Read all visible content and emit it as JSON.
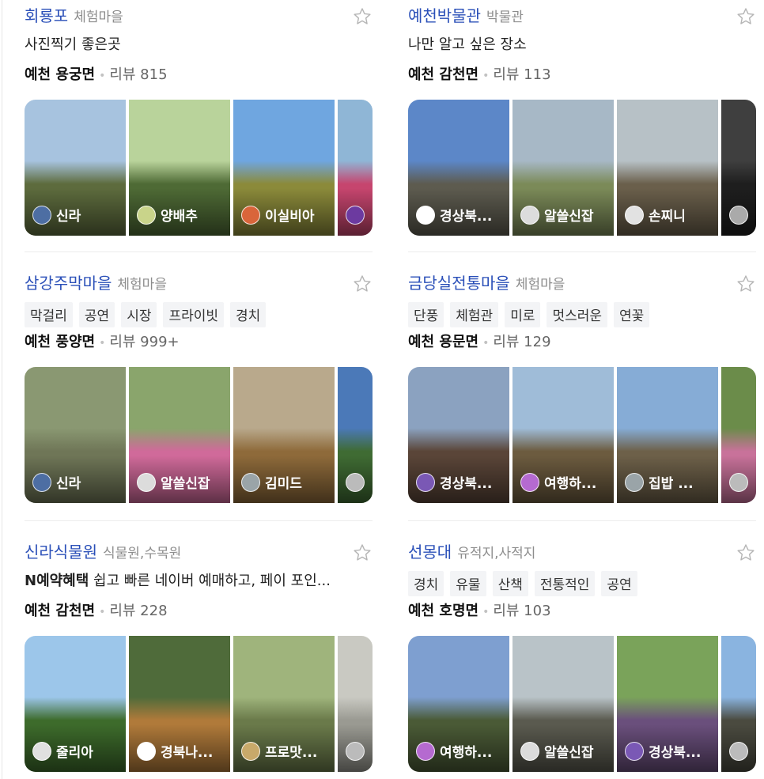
{
  "cards": [
    {
      "name": "회룡포",
      "category": "체험마을",
      "desc": "사진찍기 좋은곳",
      "location": "예천 용궁면",
      "reviews": "리뷰 815",
      "photos": [
        {
          "author": "신라",
          "sky": "#a7c3df",
          "land": "#5d6b3d",
          "av": "#4d6ea3"
        },
        {
          "author": "양배추",
          "sky": "#b9d39b",
          "land": "#4e6a35",
          "av": "#c9d48a"
        },
        {
          "author": "이실비아",
          "sky": "#6fa6e0",
          "land": "#8b8a3a",
          "av": "#d9653a"
        },
        {
          "author": "",
          "sky": "#8fb6d6",
          "land": "#c6456e",
          "av": "#6c3aa0"
        }
      ]
    },
    {
      "name": "예천박물관",
      "category": "박물관",
      "desc": "나만 알고 싶은 장소",
      "location": "예천 감천면",
      "reviews": "리뷰 113",
      "photos": [
        {
          "author": "경상북...",
          "sky": "#5c87c8",
          "land": "#5d5b4f",
          "av": "#ffffff"
        },
        {
          "author": "알쓸신잡",
          "sky": "#a7b8c6",
          "land": "#7b8a58",
          "av": "#dcdcdc"
        },
        {
          "author": "손찌니",
          "sky": "#b7c1c6",
          "land": "#6a5f4b",
          "av": "#e2e2e2"
        },
        {
          "author": "",
          "sky": "#3f3f3f",
          "land": "#1e1e1e",
          "av": "#aaaaaa"
        }
      ]
    },
    {
      "name": "삼강주막마을",
      "category": "체험마을",
      "tags": [
        "막걸리",
        "공연",
        "시장",
        "프라이빗",
        "경치"
      ],
      "location": "예천 풍양면",
      "reviews": "리뷰 999+",
      "photos": [
        {
          "author": "신라",
          "sky": "#8a9872",
          "land": "#6f7657",
          "av": "#4d6ea3"
        },
        {
          "author": "알쓸신잡",
          "sky": "#8aa56c",
          "land": "#d06a9a",
          "av": "#dcdcdc"
        },
        {
          "author": "김미드",
          "sky": "#b9a98c",
          "land": "#8e6a3a",
          "av": "#9aa4a8"
        },
        {
          "author": "",
          "sky": "#4b79b8",
          "land": "#3f6b33",
          "av": "#bbbbbb"
        }
      ]
    },
    {
      "name": "금당실전통마을",
      "category": "체험마을",
      "tags": [
        "단풍",
        "체험관",
        "미로",
        "멋스러운",
        "연꽃"
      ],
      "location": "예천 용문면",
      "reviews": "리뷰 129",
      "photos": [
        {
          "author": "경상북...",
          "sky": "#8ba2c0",
          "land": "#5a4538",
          "av": "#7a58b5"
        },
        {
          "author": "여행하...",
          "sky": "#9fbcd8",
          "land": "#6c5b3f",
          "av": "#b56ad0"
        },
        {
          "author": "집밥 ...",
          "sky": "#86acd6",
          "land": "#6d6049",
          "av": "#9aa4a8"
        },
        {
          "author": "",
          "sky": "#6b8c4a",
          "land": "#c8729a",
          "av": "#bbbbbb"
        }
      ]
    },
    {
      "name": "신라식물원",
      "category": "식물원,수목원",
      "desc_bold": "N예약혜택",
      "desc": " 쉽고 빠른 네이버 예매하고, 페이 포인...",
      "location": "예천 감천면",
      "reviews": "리뷰 228",
      "photos": [
        {
          "author": "줄리아",
          "sky": "#9cc6ea",
          "land": "#3d6b2b",
          "av": "#e0e0e0"
        },
        {
          "author": "경북나...",
          "sky": "#4f6b3a",
          "land": "#b07a3a",
          "av": "#ffffff"
        },
        {
          "author": "프로맛...",
          "sky": "#9fb47c",
          "land": "#6a7a4a",
          "av": "#c8a96a"
        },
        {
          "author": "",
          "sky": "#c9c9c2",
          "land": "#9a9a92",
          "av": "#bbbbbb"
        }
      ]
    },
    {
      "name": "선몽대",
      "category": "유적지,사적지",
      "tags": [
        "경치",
        "유물",
        "산책",
        "전통적인",
        "공연"
      ],
      "location": "예천 호명면",
      "reviews": "리뷰 103",
      "photos": [
        {
          "author": "여행하...",
          "sky": "#7e9fd0",
          "land": "#4a5a36",
          "av": "#b56ad0"
        },
        {
          "author": "알쓸신잡",
          "sky": "#b9c3c8",
          "land": "#5a5a4f",
          "av": "#dcdcdc"
        },
        {
          "author": "경상북...",
          "sky": "#7aa35a",
          "land": "#6a4f7c",
          "av": "#7a58b5"
        },
        {
          "author": "",
          "sky": "#8ab4e0",
          "land": "#4a4a3f",
          "av": "#bbbbbb"
        }
      ]
    }
  ]
}
